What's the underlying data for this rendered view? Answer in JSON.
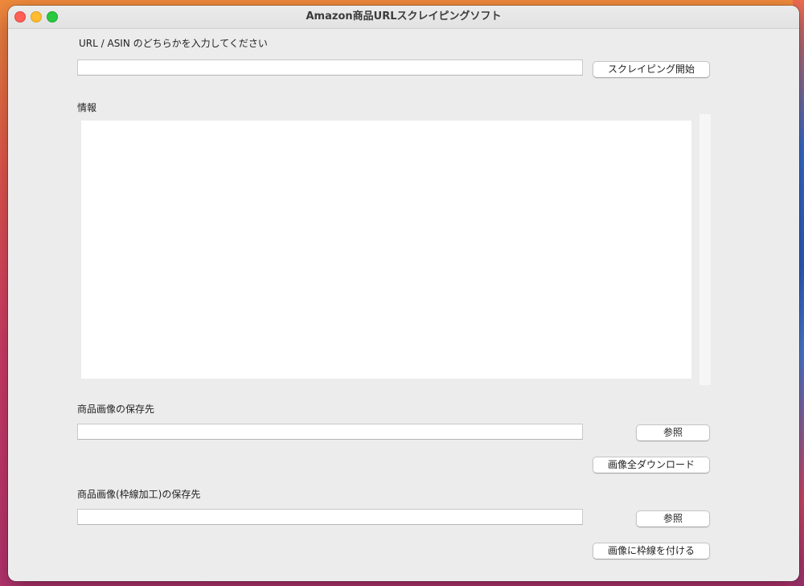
{
  "window": {
    "title": "Amazon商品URLスクレイピングソフト"
  },
  "url_section": {
    "label": "URL / ASIN のどちらかを入力してください",
    "input_value": "",
    "scrape_button": "スクレイピング開始"
  },
  "info_section": {
    "label": "情報",
    "content": ""
  },
  "image_save_section": {
    "label": "商品画像の保存先",
    "input_value": "",
    "browse_button": "参照",
    "download_all_button": "画像全ダウンロード"
  },
  "framed_image_section": {
    "label": "商品画像(枠線加工)の保存先",
    "input_value": "",
    "browse_button": "参照",
    "add_frame_button": "画像に枠線を付ける"
  },
  "colors": {
    "close": "#fe5f57",
    "minimize": "#febc2e",
    "maximize": "#28c840",
    "window_bg": "#ececec"
  }
}
